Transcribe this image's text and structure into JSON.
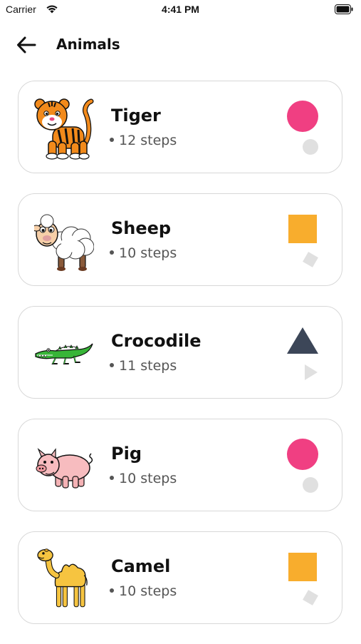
{
  "status_bar": {
    "carrier": "Carrier",
    "time": "4:41 PM"
  },
  "header": {
    "title": "Animals"
  },
  "colors": {
    "circle": "#f03f82",
    "square": "#f8ad2d",
    "triangle": "#3c4658",
    "placeholder": "#e0e0e0"
  },
  "animals": [
    {
      "name": "Tiger",
      "steps": "12 steps",
      "icon": "tiger-icon",
      "shape": "circle"
    },
    {
      "name": "Sheep",
      "steps": "10 steps",
      "icon": "sheep-icon",
      "shape": "square"
    },
    {
      "name": "Crocodile",
      "steps": "11 steps",
      "icon": "crocodile-icon",
      "shape": "triangle"
    },
    {
      "name": "Pig",
      "steps": "10 steps",
      "icon": "pig-icon",
      "shape": "circle"
    },
    {
      "name": "Camel",
      "steps": "10 steps",
      "icon": "camel-icon",
      "shape": "square"
    }
  ]
}
